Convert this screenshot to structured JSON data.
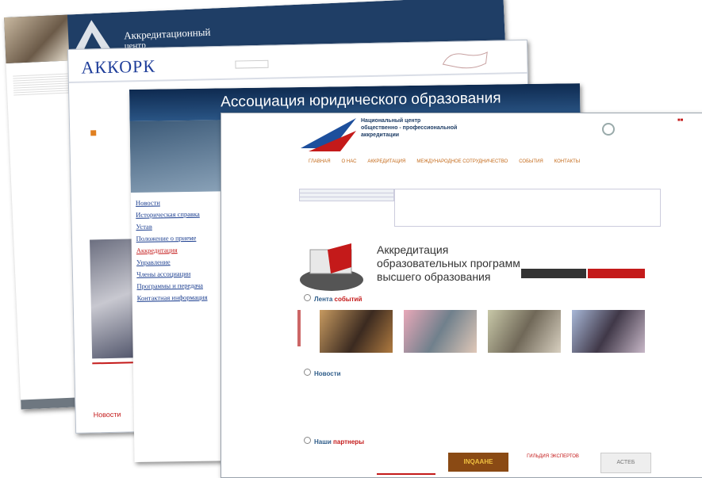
{
  "slide": {
    "title_prefix": "",
    "title_highlight": "",
    "title_suffix": ""
  },
  "site1": {
    "header_small": "",
    "header_title": "Аккредитационный",
    "header_title2": "центр",
    "login_label": "",
    "menu": [
      "",
      "",
      "",
      "",
      "",
      "",
      "",
      "",
      ""
    ]
  },
  "site2": {
    "logo": "АККОРК",
    "logo_desc": "",
    "search_label": "",
    "link_right": "",
    "bottom_text": "",
    "footer_link": "Новости"
  },
  "site3": {
    "banner": "Ассоциация юридического образования",
    "menu": [
      "Новости",
      "Историческая справка",
      "Устав",
      "Положение о приеме",
      "Аккредитация",
      "Управление",
      "Члены ассоциации",
      "Программы и передача",
      "Контактная информация"
    ]
  },
  "site4": {
    "logo_lines": [
      "Национальный центр",
      "общественно - профессиональной",
      "аккредитации"
    ],
    "header_info": "",
    "nav": [
      "ГЛАВНАЯ",
      "О НАС",
      "АККРЕДИТАЦИЯ",
      "МЕЖДУНАРОДНОЕ СОТРУДНИЧЕСТВО",
      "СОБЫТИЯ",
      "КОНТАКТЫ"
    ],
    "side_tabs": [
      "",
      "",
      ""
    ],
    "intro": "",
    "hero_lines": [
      "Аккредитация",
      "образовательных программ",
      "высшего образования"
    ],
    "hero_right_text": "",
    "btn1": "",
    "btn2": "",
    "events_heading_a": "Лента",
    "events_heading_b": "событий",
    "event_captions": [
      "",
      "",
      "",
      ""
    ],
    "news_heading": "Новости",
    "news": [
      "",
      "",
      "",
      "",
      ""
    ],
    "partners_heading_a": "Наши",
    "partners_heading_b": "партнеры",
    "partners": [
      "",
      "",
      "INQAAHE",
      "ГИЛЬДИЯ ЭКСПЕРТОВ",
      "АСТЕБ"
    ]
  },
  "colors": {
    "accent_red": "#c41a1a",
    "dark_blue": "#1f3e66",
    "heading_blue": "#2f5d8a"
  }
}
